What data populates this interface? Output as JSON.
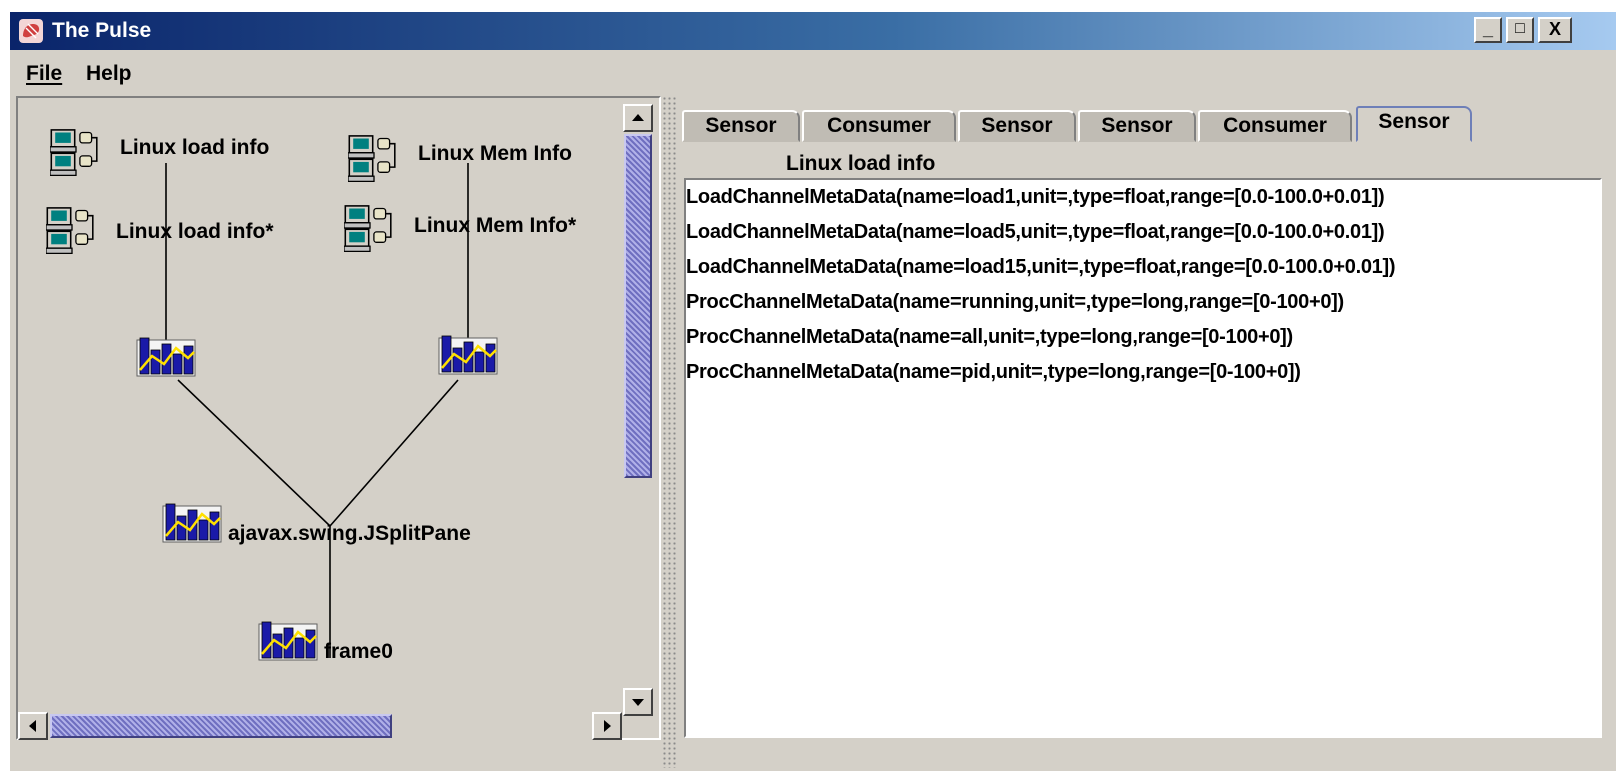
{
  "window": {
    "title": "The Pulse",
    "controls": {
      "minimize": "_",
      "maximize": "□",
      "close": "X"
    }
  },
  "menu": [
    {
      "label": "File"
    },
    {
      "label": "Help"
    }
  ],
  "graph": {
    "nodes": [
      {
        "label": "Linux load info",
        "icon": "sensor-computer-icon"
      },
      {
        "label": "Linux load info*",
        "icon": "sensor-computer-icon"
      },
      {
        "label": "Linux Mem Info",
        "icon": "sensor-computer-icon"
      },
      {
        "label": "Linux Mem Info*",
        "icon": "sensor-computer-icon"
      },
      {
        "label": "",
        "icon": "consumer-chart-icon"
      },
      {
        "label": "",
        "icon": "consumer-chart-icon"
      },
      {
        "label": "ajavax.swing.JSplitPane",
        "icon": "consumer-chart-icon"
      },
      {
        "label": "frame0",
        "icon": "consumer-chart-icon"
      }
    ]
  },
  "tabs": [
    {
      "label": "Sensor",
      "active": false
    },
    {
      "label": "Consumer",
      "active": false
    },
    {
      "label": "Sensor",
      "active": false
    },
    {
      "label": "Sensor",
      "active": false
    },
    {
      "label": "Consumer",
      "active": false
    },
    {
      "label": "Sensor",
      "active": true
    }
  ],
  "panel": {
    "title": "Linux load info",
    "items": [
      "LoadChannelMetaData(name=load1,unit=,type=float,range=[0.0-100.0+0.01])",
      "LoadChannelMetaData(name=load5,unit=,type=float,range=[0.0-100.0+0.01])",
      "LoadChannelMetaData(name=load15,unit=,type=float,range=[0.0-100.0+0.01])",
      "ProcChannelMetaData(name=running,unit=,type=long,range=[0-100+0])",
      "ProcChannelMetaData(name=all,unit=,type=long,range=[0-100+0])",
      "ProcChannelMetaData(name=pid,unit=,type=long,range=[0-100+0])"
    ]
  },
  "colors": {
    "titlebar_start": "#0a246a",
    "titlebar_end": "#a6caf0",
    "window_bg": "#d4d0c8",
    "scroll_thumb": "#8c8cd4"
  }
}
